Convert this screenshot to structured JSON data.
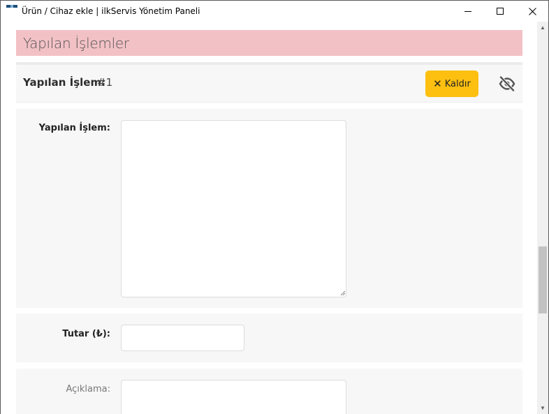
{
  "window": {
    "title": "Ürün / Cihaz ekle | ilkServis Yönetim Paneli",
    "controls": {
      "minimize": "minimize",
      "maximize": "maximize",
      "close": "close"
    }
  },
  "section": {
    "title": "Yapılan İşlemler"
  },
  "item": {
    "title": "Yapılan İşlem:",
    "number": "#1",
    "remove_icon": "✕",
    "remove_label": "Kaldır",
    "visibility_icon": "eye-slash-icon"
  },
  "fields": {
    "islem_label": "Yapılan İşlem:",
    "islem_value": "",
    "tutar_label": "Tutar (₺):",
    "tutar_value": "",
    "aciklama_label": "Açıklama:",
    "aciklama_value": ""
  },
  "colors": {
    "section_bg": "#f2c1c6",
    "button_bg": "#fdbf10",
    "panel_bg": "#f7f7f7"
  }
}
